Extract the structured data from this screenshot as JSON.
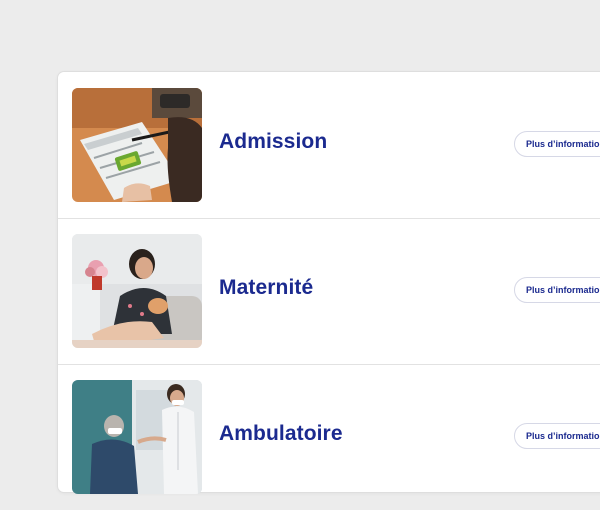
{
  "services": [
    {
      "title": "Admission",
      "button_label": "Plus d’informations",
      "image": "admission-form-photo"
    },
    {
      "title": "Maternité",
      "button_label": "Plus d’informations",
      "image": "mother-baby-photo"
    },
    {
      "title": "Ambulatoire",
      "button_label": "Plus d’informations",
      "image": "nurse-patient-photo"
    }
  ],
  "colors": {
    "background": "#ececec",
    "panel": "#ffffff",
    "title": "#1b2a8f",
    "button_border": "#d6d8e6"
  }
}
